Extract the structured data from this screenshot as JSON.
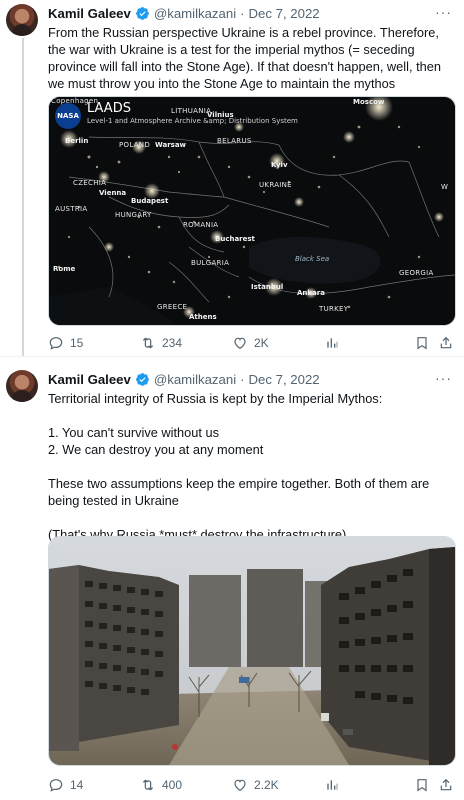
{
  "tweets": [
    {
      "author": {
        "name": "Kamil Galeev",
        "handle": "@kamilkazani",
        "date": "Dec 7, 2022"
      },
      "text": [
        "From the Russian perspective Ukraine is a rebel province. Therefore, the war with Ukraine is a test for the imperial mythos (= seceding province will fall into the Stone Age). If that doesn't happen, well, then we must throw you into the Stone Age to maintain the  mythos"
      ],
      "media": {
        "badge": "NASA",
        "title": "LAADS",
        "subtitle": "Level-1 and Atmosphere Archive &amp; Distribution System",
        "corner": "Copenhagen",
        "sea": "Black Sea",
        "labels": [
          "LITHUANIA",
          "Vilnius",
          "Moscow",
          "Berlin",
          "POLAND",
          "Warsaw",
          "BELARUS",
          "Kyiv",
          "UKRAINE",
          "CZECHIA",
          "Vienna",
          "Budapest",
          "AUSTRIA",
          "HUNGARY",
          "ROMANIA",
          "Bucharest",
          "BULGARIA",
          "Rome",
          "Istanbul",
          "Ankara",
          "GEORGIA",
          "GREECE",
          "TURKEY",
          "Athens",
          "W"
        ]
      },
      "stats": {
        "replies": "15",
        "retweets": "234",
        "likes": "2K"
      }
    },
    {
      "author": {
        "name": "Kamil Galeev",
        "handle": "@kamilkazani",
        "date": "Dec 7, 2022"
      },
      "text": [
        "Territorial integrity of Russia is kept by the Imperial Mythos:",
        "",
        "1. You can't survive without us",
        "2. We can destroy you at any moment",
        "",
        "These two assumptions keep the empire together. Both of them are being tested in Ukraine",
        "",
        "(That's why Russia *must* destroy the infrastructure)"
      ],
      "stats": {
        "replies": "14",
        "retweets": "400",
        "likes": "2.2K"
      }
    }
  ],
  "colors": {
    "accent": "#1d9bf0",
    "muted": "#536471",
    "text": "#0f1419",
    "border": "#cfd9de"
  },
  "icons": [
    "verified-badge-icon",
    "more-icon",
    "reply-icon",
    "retweet-icon",
    "like-icon",
    "views-icon",
    "bookmark-icon",
    "share-icon"
  ]
}
